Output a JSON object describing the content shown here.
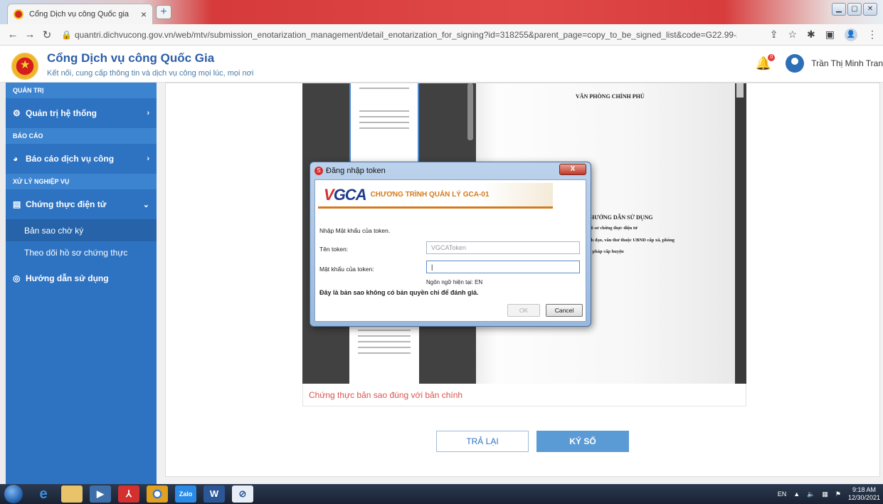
{
  "browser": {
    "tab_title": "Cổng Dịch vụ công Quốc gia",
    "tab_close": "×",
    "new_tab": "+",
    "url": "quantri.dichvucong.gov.vn/web/mtv/submission_enotarization_management/detail_enotarization_for_signing?id=318255&parent_page=copy_to_be_signed_list&code=G22.99-211230-010158"
  },
  "header": {
    "site_title": "Cổng Dịch vụ công Quốc Gia",
    "site_subtitle": "Kết nối, cung cấp thông tin và dịch vụ công mọi lúc, mọi nơi",
    "notification_count": "0",
    "user_name": "Trần Thị Minh Tran"
  },
  "sidebar": {
    "section_admin": "QUẢN TRỊ",
    "item_system": "Quản trị hệ thống",
    "section_report": "BÁO CÁO",
    "item_report": "Báo cáo dịch vụ công",
    "section_business": "XỬ LÝ NGHIỆP VỤ",
    "item_certification": "Chứng thực điện tử",
    "sub_pending": "Bản sao chờ ký",
    "sub_tracking": "Theo dõi hồ sơ chứng thực",
    "item_guide": "Hướng dẫn sử dụng"
  },
  "document": {
    "header": "VĂN PHÒNG CHÍNH PHỦ",
    "title": "HƯỚNG DẪN SỬ DỤNG",
    "line1": "hồ sơ chứng thực điện tử",
    "line2": "nh đạo, văn thư thuộc UBND cấp xã, phòng",
    "line3": "ư pháp cấp huyện",
    "copy_note": "Chứng thực bản sao đúng với bản chính"
  },
  "actions": {
    "return_label": "TRẢ LẠI",
    "sign_label": "KÝ SỐ"
  },
  "dialog": {
    "title": "Đăng nhập token",
    "close": "X",
    "brand": "GCA",
    "program": "CHƯƠNG TRÌNH QUẢN LÝ GCA-01",
    "prompt": "Nhập Mật khẩu của token.",
    "token_name_label": "Tên token:",
    "token_name_value": "VGCAToken",
    "password_label": "Mật khẩu của token:",
    "password_value": "",
    "language": "Ngôn ngữ hiện tại: EN",
    "trial_notice": "Đây là bản sao không có bản quyền chỉ để đánh giá.",
    "ok_label": "OK",
    "cancel_label": "Cancel"
  },
  "taskbar": {
    "lang": "EN",
    "time": "9:18 AM",
    "date": "12/30/2021"
  }
}
